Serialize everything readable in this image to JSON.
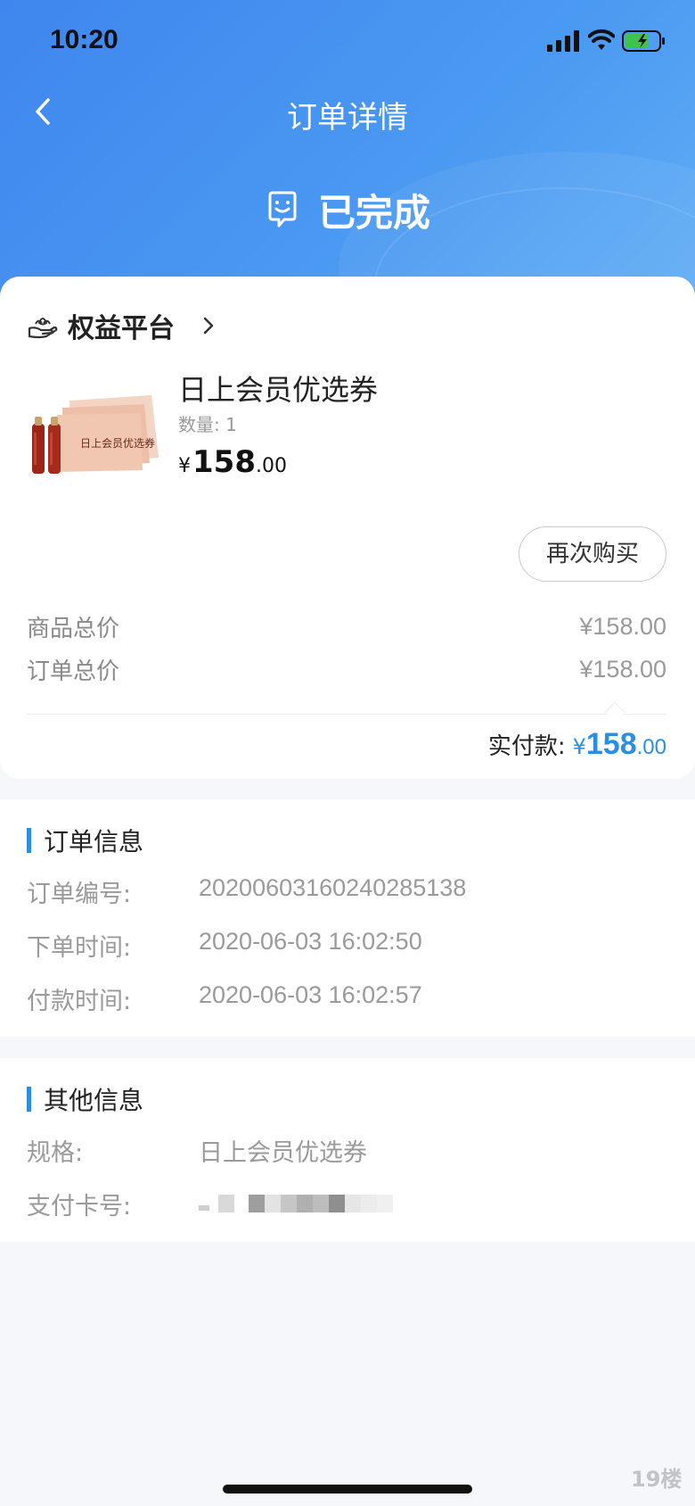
{
  "status_bar": {
    "time": "10:20"
  },
  "nav": {
    "title": "订单详情"
  },
  "order_status": {
    "text": "已完成",
    "icon": "receipt-smile-icon"
  },
  "store": {
    "name": "权益平台",
    "icon": "hand-lotus-icon"
  },
  "product": {
    "name": "日上会员优选券",
    "quantity": "数量: 1",
    "thumb_text": "日上会员优选券",
    "price_currency": "¥",
    "price_integer": "158",
    "price_decimal": ".00"
  },
  "actions": {
    "rebuy": "再次购买"
  },
  "summary": {
    "goods_total_label": "商品总价",
    "goods_total_value": "¥158.00",
    "order_total_label": "订单总价",
    "order_total_value": "¥158.00",
    "paid_label": "实付款:",
    "paid_currency": "¥",
    "paid_integer": "158",
    "paid_decimal": ".00"
  },
  "order_info": {
    "title": "订单信息",
    "rows": [
      {
        "label": "订单编号:",
        "value": "20200603160240285138"
      },
      {
        "label": "下单时间:",
        "value": "2020-06-03 16:02:50"
      },
      {
        "label": "付款时间:",
        "value": "2020-06-03 16:02:57"
      }
    ]
  },
  "other_info": {
    "title": "其他信息",
    "spec_label": "规格:",
    "spec_value": "日上会员优选券",
    "card_label": "支付卡号:"
  },
  "watermark": {
    "text": "19楼"
  },
  "colors": {
    "header_blue": "#4b9af2",
    "accent_blue": "#2a8fe0"
  }
}
